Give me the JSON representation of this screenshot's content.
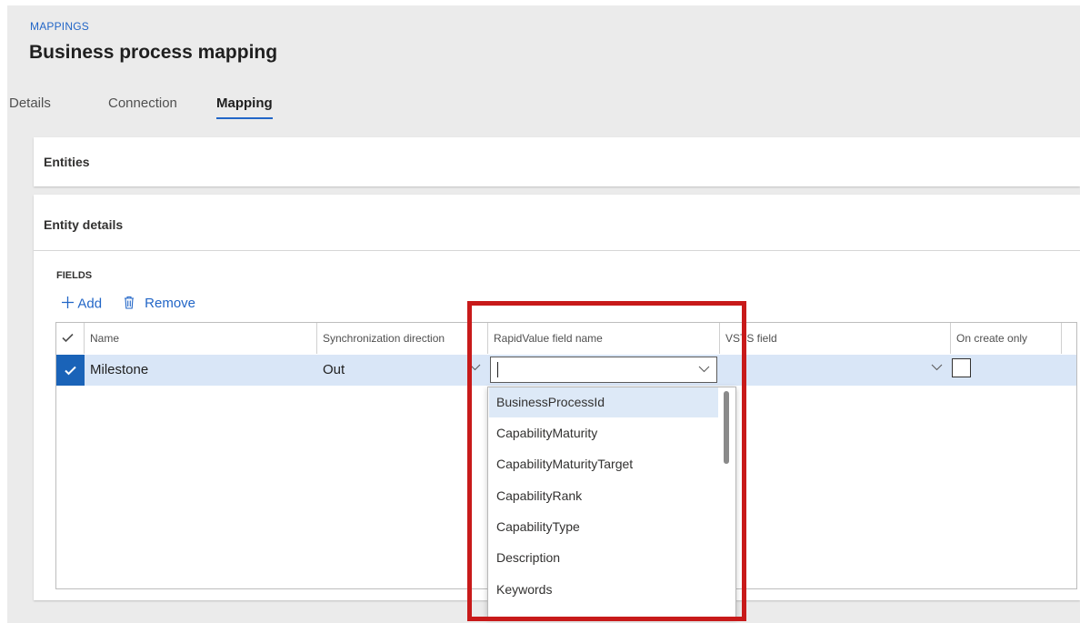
{
  "header": {
    "breadcrumb": "MAPPINGS",
    "title": "Business process mapping"
  },
  "tabs": [
    {
      "label": "Details",
      "active": false
    },
    {
      "label": "Connection",
      "active": false
    },
    {
      "label": "Mapping",
      "active": true
    }
  ],
  "cards": {
    "entities_title": "Entities",
    "details_title": "Entity details"
  },
  "fields": {
    "section_label": "FIELDS",
    "toolbar": {
      "add_label": "Add",
      "remove_label": "Remove"
    },
    "columns": [
      "Name",
      "Synchronization direction",
      "RapidValue field name",
      "VSTS field",
      "On create only"
    ],
    "rows": [
      {
        "selected": true,
        "name": "Milestone",
        "direction": "Out",
        "rapidvalue_field": "",
        "vsts_field": "",
        "on_create_only": false
      }
    ]
  },
  "dropdown": {
    "options": [
      "BusinessProcessId",
      "CapabilityMaturity",
      "CapabilityMaturityTarget",
      "CapabilityRank",
      "CapabilityType",
      "Description",
      "Keywords"
    ],
    "highlighted_index": 0
  },
  "colors": {
    "accent": "#2266c7",
    "selection": "#1a63b8",
    "highlight_box": "#c81a1a"
  }
}
